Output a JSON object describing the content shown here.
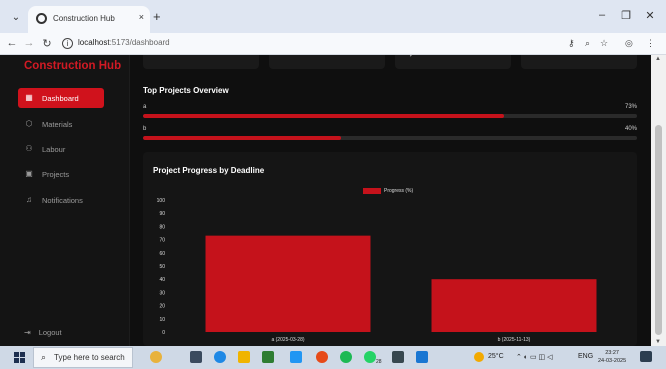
{
  "browser": {
    "tab_title": "Construction Hub",
    "tab_close": "×",
    "new_tab": "+",
    "url_host": "localhost",
    "url_path": ":5173/dashboard",
    "window_controls": {
      "minimize": "–",
      "restore": "❐",
      "close": "✕"
    }
  },
  "app": {
    "brand": "Construction Hub",
    "nav": [
      {
        "label": "Dashboard",
        "icon": "grid-icon",
        "active": true
      },
      {
        "label": "Materials",
        "icon": "box-icon",
        "active": false
      },
      {
        "label": "Labour",
        "icon": "users-icon",
        "active": false
      },
      {
        "label": "Projects",
        "icon": "folder-icon",
        "active": false
      },
      {
        "label": "Notifications",
        "icon": "bell-icon",
        "active": false
      }
    ],
    "logout": "Logout"
  },
  "overview": {
    "title": "Top Projects Overview",
    "projects": [
      {
        "name": "a",
        "percent_label": "73%",
        "progress": 0.73
      },
      {
        "name": "b",
        "percent_label": "40%",
        "progress": 0.4
      }
    ]
  },
  "chart_data": {
    "type": "bar",
    "title": "Project Progress by Deadline",
    "categories": [
      "a (2025-03-28)",
      "b (2025-11-13)"
    ],
    "series": [
      {
        "name": "Progress (%)",
        "values": [
          73,
          40
        ],
        "color": "#c5121b"
      }
    ],
    "yticks": [
      0,
      10,
      20,
      30,
      40,
      50,
      60,
      70,
      80,
      90,
      100
    ],
    "ylim": [
      0,
      100
    ],
    "legend_position": "top-center",
    "grid": false
  },
  "taskbar": {
    "search_placeholder": "Type here to search",
    "weather": "25°C",
    "language": "ENG",
    "time": "23:27",
    "date": "24-03-2025",
    "badge": "28"
  }
}
